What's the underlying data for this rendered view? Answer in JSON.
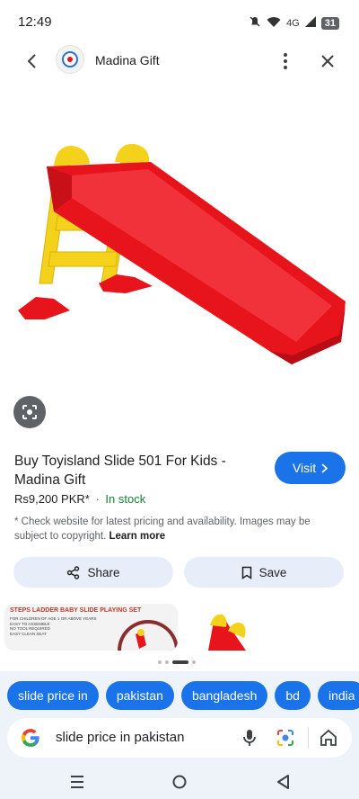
{
  "status": {
    "time": "12:49",
    "network": "4G",
    "battery": "31",
    "icons": [
      "mute-icon",
      "wifi-icon",
      "signal-icon",
      "battery-icon"
    ]
  },
  "header": {
    "site_name": "Madina Gift",
    "icons": [
      "back-arrow-icon",
      "more-vert-icon",
      "close-icon"
    ]
  },
  "product": {
    "title": "Buy Toyisland Slide 501 For Kids - Madina Gift",
    "price": "Rs9,200 PKR*",
    "separator": "·",
    "stock": "In stock",
    "disclaimer": "* Check website for latest pricing and availability. Images may be subject to copyright.",
    "learn_more": "Learn more",
    "visit_label": "Visit"
  },
  "actions": {
    "share_label": "Share",
    "save_label": "Save"
  },
  "related": {
    "card1_caption": "STEPS LADDER BABY SLIDE PLAYING SET",
    "card1_sub": "FOR CHILDREN OF AGE 1 OR ABOVE YEARS\nEASY TO ASSEMBLE\nNO TOOL REQUIRED\nEASY CLEAN SEAT"
  },
  "chips": [
    "slide price in",
    "pakistan",
    "bangladesh",
    "bd",
    "india"
  ],
  "search": {
    "query": "slide price in pakistan"
  },
  "colors": {
    "accent": "#1a73e8",
    "stock_green": "#188038",
    "slide_red": "#e8141c",
    "slide_yellow": "#f4d21c",
    "panel_bg": "#eef2f9",
    "action_bg": "#e8eef9"
  }
}
